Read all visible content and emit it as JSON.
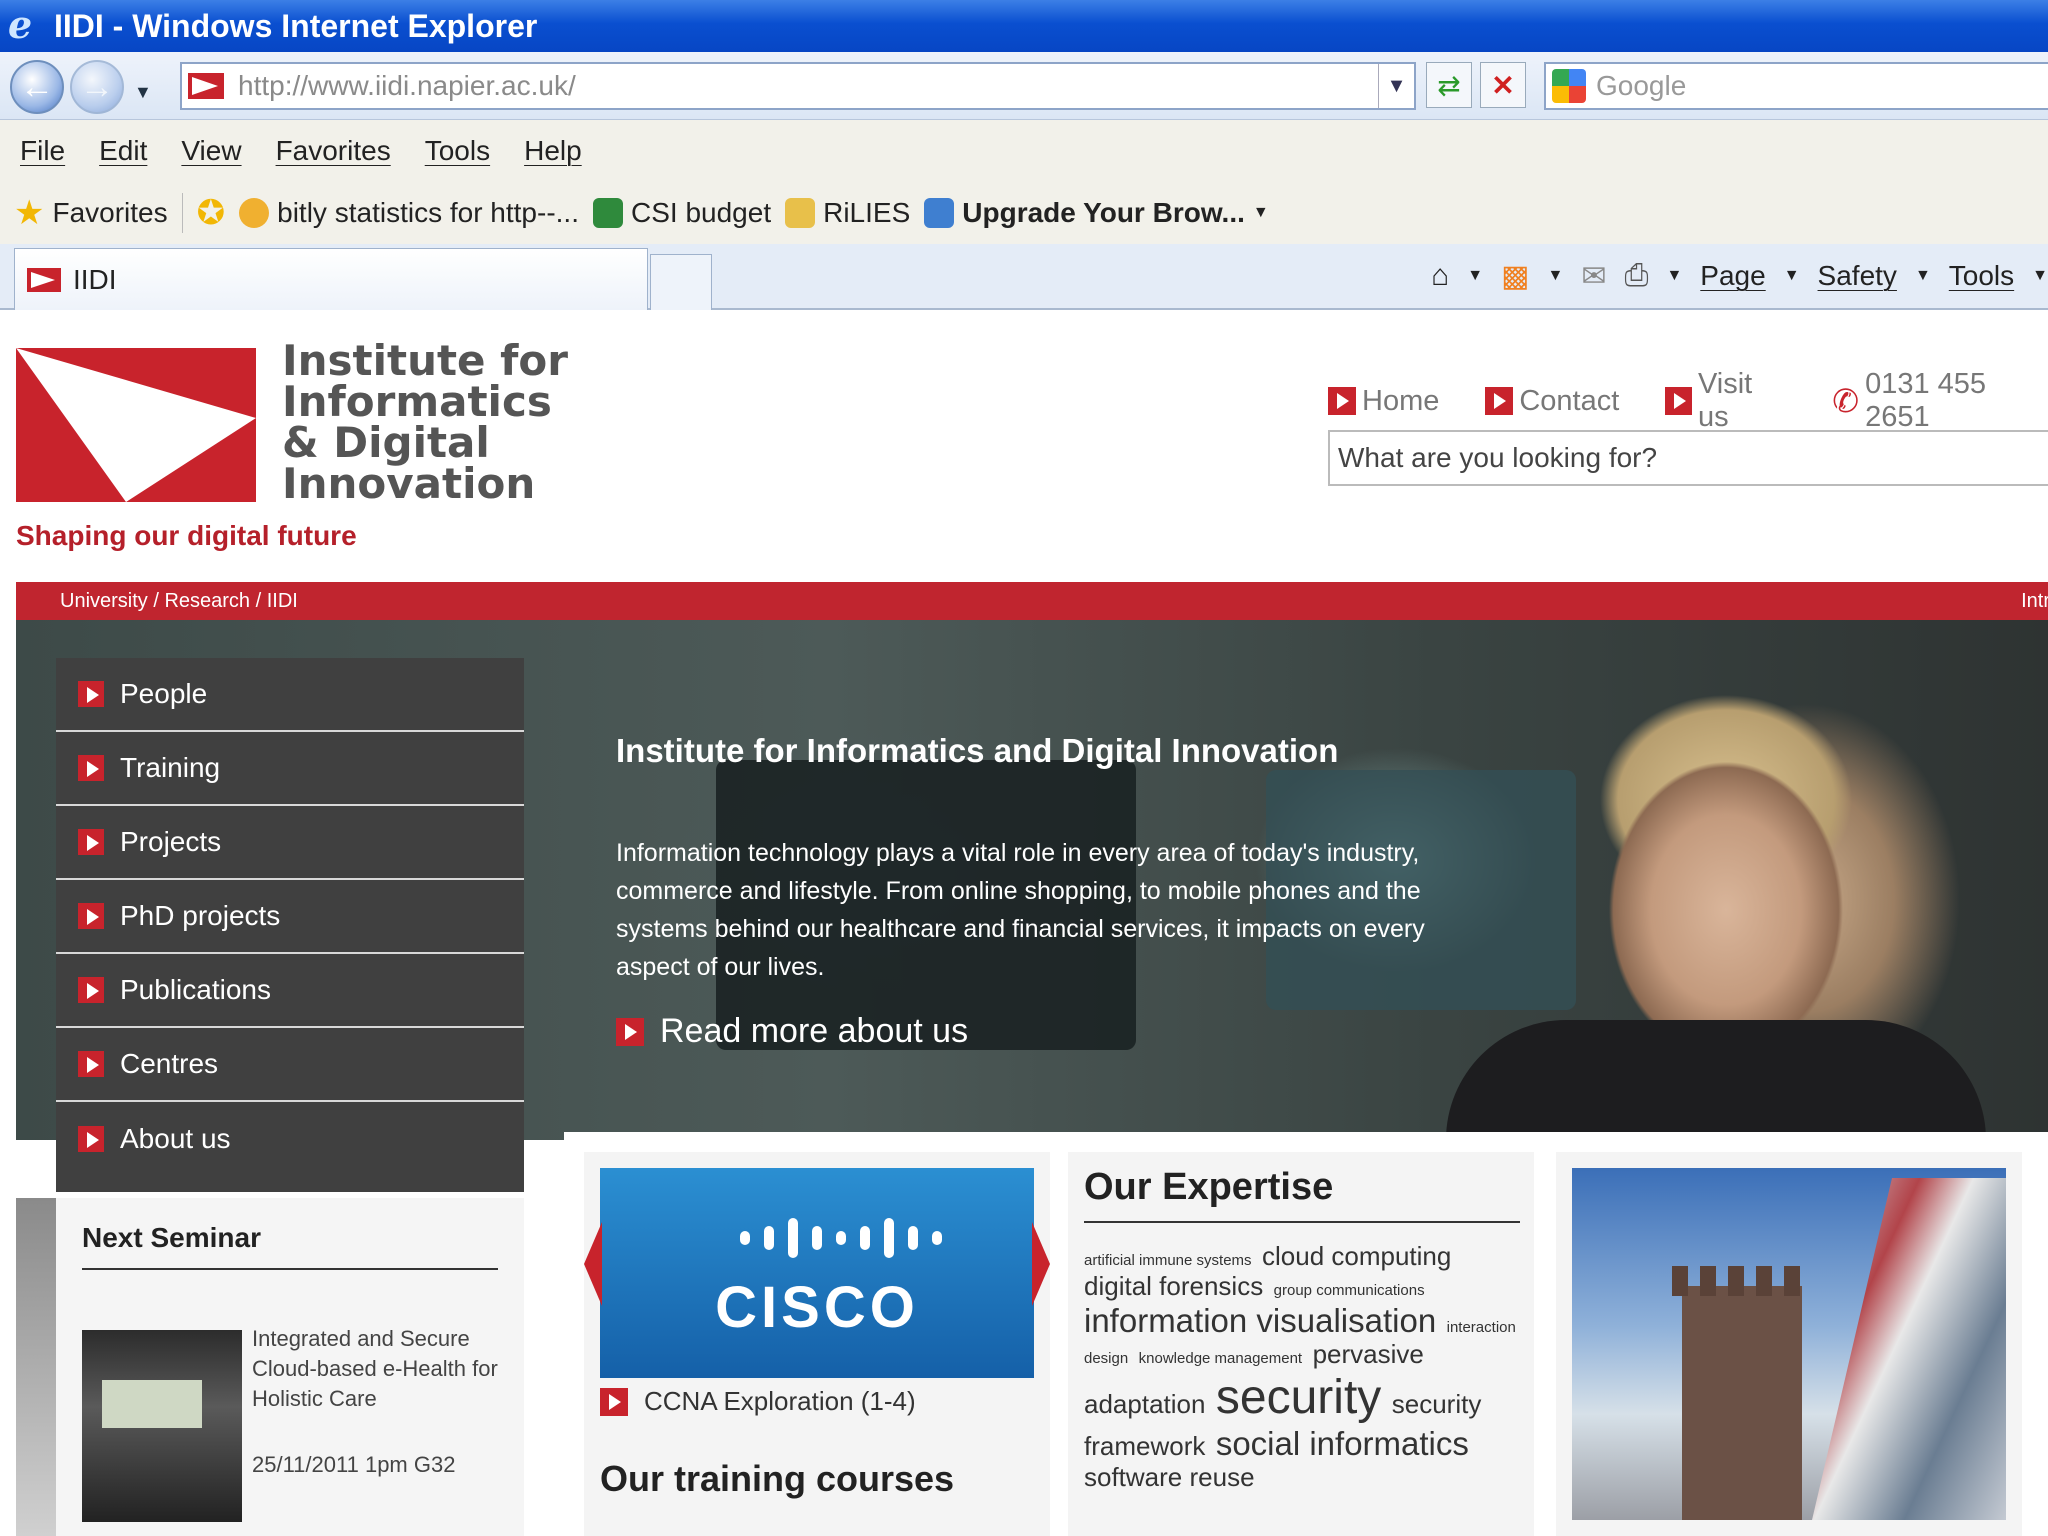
{
  "window": {
    "title": "IIDI - Windows Internet Explorer"
  },
  "address": {
    "url": "http://www.iidi.napier.ac.uk/",
    "search_placeholder": "Google"
  },
  "menu": [
    "File",
    "Edit",
    "View",
    "Favorites",
    "Tools",
    "Help"
  ],
  "favorites": {
    "label": "Favorites",
    "items": [
      "bitly statistics for http--...",
      "CSI budget",
      "RiLIES",
      "Upgrade Your Brow..."
    ]
  },
  "tab": {
    "title": "IIDI"
  },
  "commandbar": {
    "page": "Page",
    "safety": "Safety",
    "tools": "Tools"
  },
  "site": {
    "logo_lines": [
      "Institute for",
      "Informatics",
      "& Digital",
      "Innovation"
    ],
    "tagline": "Shaping our digital future",
    "toplinks": [
      "Home",
      "Contact",
      "Visit us"
    ],
    "phone": "0131 455 2651",
    "search_placeholder": "What are you looking for?",
    "breadcrumb": "University / Research / IIDI",
    "breadcrumb_right": "Intr"
  },
  "nav": [
    "People",
    "Training",
    "Projects",
    "PhD projects",
    "Publications",
    "Centres",
    "About us"
  ],
  "hero": {
    "title": "Institute for Informatics and Digital Innovation",
    "body": "Information technology plays a vital role in every area of today's industry, commerce and lifestyle. From online shopping, to mobile phones and the systems behind our healthcare and financial services, it impacts on every aspect of our lives.",
    "read_more": "Read more about us"
  },
  "seminar": {
    "heading": "Next Seminar",
    "title": "Integrated and Secure Cloud-based e-Health for Holistic Care",
    "date": "25/11/2011 1pm G32"
  },
  "training_panel": {
    "logo_word": "CISCO",
    "link": "CCNA Exploration (1-4)",
    "heading": "Our training courses"
  },
  "expertise": {
    "heading": "Our Expertise",
    "tags": [
      {
        "t": "artificial immune systems",
        "s": 1
      },
      {
        "t": "cloud computing",
        "s": 2
      },
      {
        "t": "digital forensics",
        "s": 2
      },
      {
        "t": "group communications",
        "s": 1
      },
      {
        "t": "information visualisation",
        "s": 3
      },
      {
        "t": "interaction design",
        "s": 1
      },
      {
        "t": "knowledge management",
        "s": 1
      },
      {
        "t": "pervasive",
        "s": 2
      },
      {
        "t": "adaptation",
        "s": 2
      },
      {
        "t": "security",
        "s": 4
      },
      {
        "t": "security framework",
        "s": 2
      },
      {
        "t": "social informatics",
        "s": 3
      },
      {
        "t": "software reuse",
        "s": 2
      }
    ]
  }
}
